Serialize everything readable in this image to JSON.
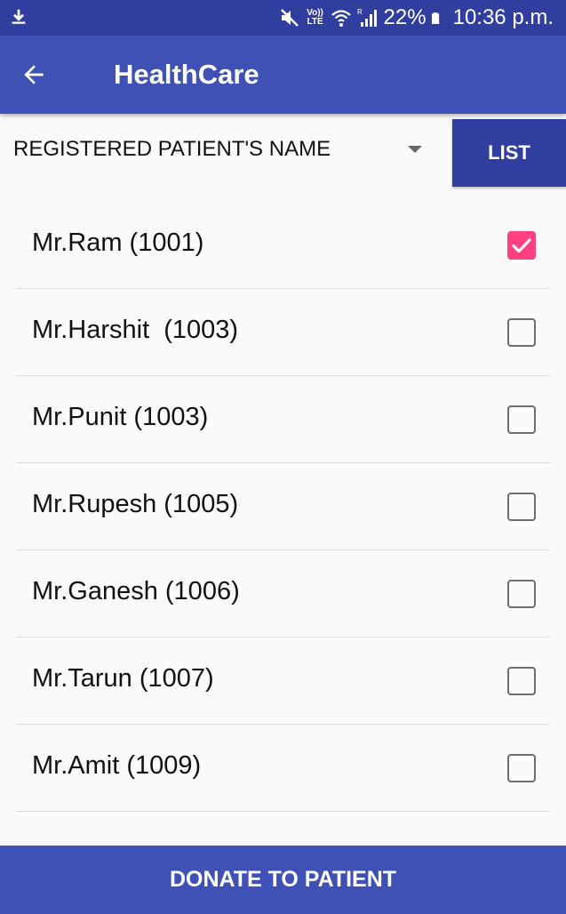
{
  "status_bar": {
    "icons": [
      "download-icon",
      "mute-icon",
      "volte-icon",
      "wifi-icon",
      "signal-icon",
      "battery-icon"
    ],
    "volte_text": "Vo)) LTE",
    "signal_label": "R",
    "battery": "22%",
    "time": "10:36 p.m."
  },
  "app_bar": {
    "back_icon": "arrow-back-icon",
    "title": "HealthCare",
    "color": "#3f51b5"
  },
  "spinner": {
    "selected": "REGISTERED PATIENT'S NAME"
  },
  "list_button": {
    "label": "LIST",
    "color": "#303f9f"
  },
  "patients": [
    {
      "name": "Mr.Ram (1001)",
      "checked": true
    },
    {
      "name": "Mr.Harshit  (1003)",
      "checked": false
    },
    {
      "name": "Mr.Punit (1003)",
      "checked": false
    },
    {
      "name": "Mr.Rupesh (1005)",
      "checked": false
    },
    {
      "name": "Mr.Ganesh (1006)",
      "checked": false
    },
    {
      "name": "Mr.Tarun (1007)",
      "checked": false
    },
    {
      "name": "Mr.Amit (1009)",
      "checked": false
    }
  ],
  "checkbox_accent": "#ff4081",
  "donate_button": {
    "label": "DONATE TO PATIENT"
  }
}
